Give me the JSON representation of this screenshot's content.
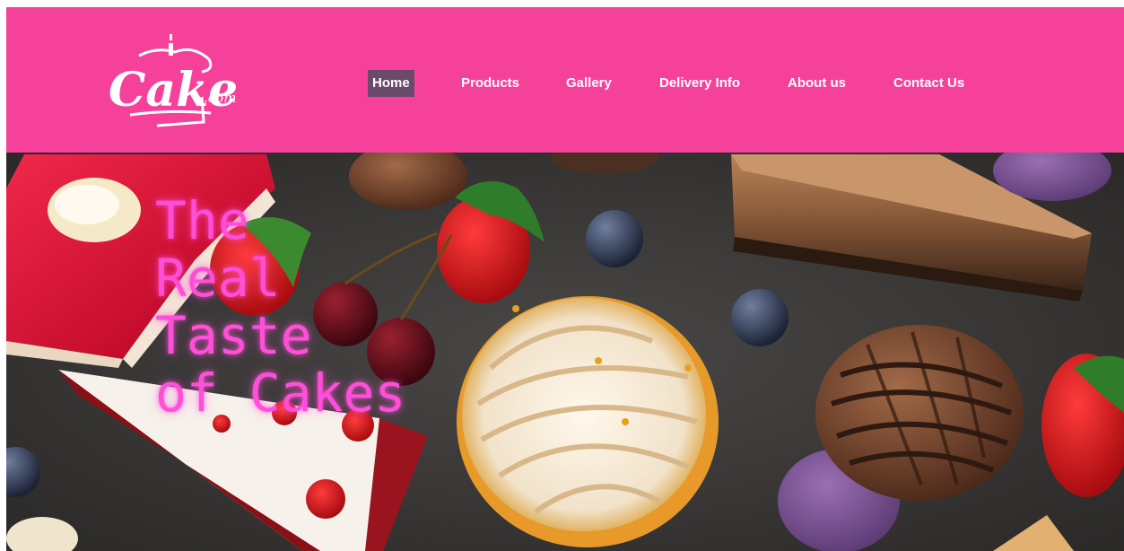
{
  "logo": {
    "text": "Cakes",
    "suffix": ".com."
  },
  "nav": {
    "items": [
      {
        "label": "Home",
        "active": true
      },
      {
        "label": "Products",
        "active": false
      },
      {
        "label": "Gallery",
        "active": false
      },
      {
        "label": "Delivery Info",
        "active": false
      },
      {
        "label": "About us",
        "active": false
      },
      {
        "label": "Contact Us",
        "active": false
      }
    ]
  },
  "hero": {
    "tagline_lines": [
      "The",
      "Real",
      "Taste",
      "of Cakes"
    ]
  },
  "colors": {
    "header_bg": "#f6419a",
    "nav_active_bg": "#6a4a6a",
    "tagline": "#ff4fd8",
    "hero_bg": "#3e3c3b"
  }
}
